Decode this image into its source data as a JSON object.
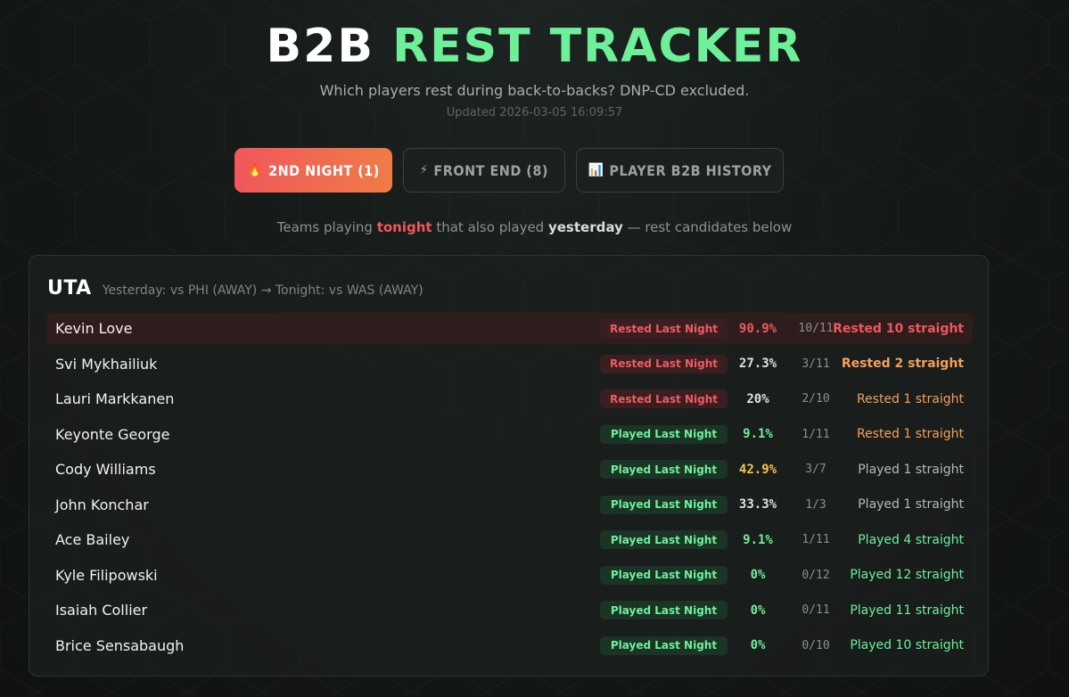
{
  "header": {
    "title_white": "B2B",
    "title_green": "REST TRACKER",
    "subtitle": "Which players rest during back-to-backs? DNP-CD excluded.",
    "updated": "Updated 2026-03-05 16:09:57"
  },
  "tabs": [
    {
      "icon": "🔥",
      "label": "2ND NIGHT (1)",
      "active": true
    },
    {
      "icon": "⚡",
      "label": "FRONT END (8)",
      "active": false
    },
    {
      "icon": "📊",
      "label": "PLAYER B2B HISTORY",
      "active": false
    }
  ],
  "description": {
    "pre": "Teams playing ",
    "tonight": "tonight",
    "mid": " that also played ",
    "yesterday": "yesterday",
    "post": " — rest candidates below"
  },
  "team": {
    "abbr": "UTA",
    "schedule": "Yesterday: vs PHI (AWAY) → Tonight: vs WAS (AWAY)"
  },
  "colors": {
    "accent_green": "#6ef09a",
    "accent_red": "#f0575c",
    "accent_orange": "#f5a05a",
    "accent_yellow": "#f5c451"
  },
  "players": [
    {
      "name": "Kevin Love",
      "status": "Rested Last Night",
      "pct": "90.9%",
      "frac": "10/11",
      "streak": "Rested 10 straight"
    },
    {
      "name": "Svi Mykhailiuk",
      "status": "Rested Last Night",
      "pct": "27.3%",
      "frac": "3/11",
      "streak": "Rested 2 straight"
    },
    {
      "name": "Lauri Markkanen",
      "status": "Rested Last Night",
      "pct": "20%",
      "frac": "2/10",
      "streak": "Rested 1 straight"
    },
    {
      "name": "Keyonte George",
      "status": "Played Last Night",
      "pct": "9.1%",
      "frac": "1/11",
      "streak": "Rested 1 straight"
    },
    {
      "name": "Cody Williams",
      "status": "Played Last Night",
      "pct": "42.9%",
      "frac": "3/7",
      "streak": "Played 1 straight"
    },
    {
      "name": "John Konchar",
      "status": "Played Last Night",
      "pct": "33.3%",
      "frac": "1/3",
      "streak": "Played 1 straight"
    },
    {
      "name": "Ace Bailey",
      "status": "Played Last Night",
      "pct": "9.1%",
      "frac": "1/11",
      "streak": "Played 4 straight"
    },
    {
      "name": "Kyle Filipowski",
      "status": "Played Last Night",
      "pct": "0%",
      "frac": "0/12",
      "streak": "Played 12 straight"
    },
    {
      "name": "Isaiah Collier",
      "status": "Played Last Night",
      "pct": "0%",
      "frac": "0/11",
      "streak": "Played 11 straight"
    },
    {
      "name": "Brice Sensabaugh",
      "status": "Played Last Night",
      "pct": "0%",
      "frac": "0/10",
      "streak": "Played 10 straight"
    }
  ]
}
